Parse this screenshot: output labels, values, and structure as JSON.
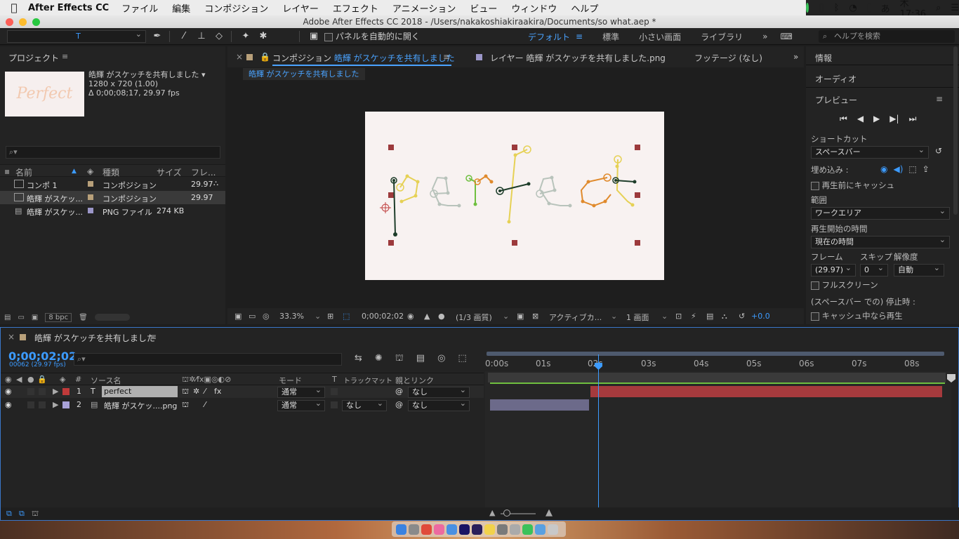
{
  "menubar": {
    "app_name": "After Effects CC",
    "items": [
      "ファイル",
      "編集",
      "コンポジション",
      "レイヤー",
      "エフェクト",
      "アニメーション",
      "ビュー",
      "ウィンドウ",
      "ヘルプ"
    ],
    "ime": "あ",
    "clock": "木 17:36"
  },
  "window_title": "Adobe After Effects CC 2018 - /Users/nakakoshiakiraakira/Documents/so what.aep *",
  "toolbar": {
    "auto_open_label": "パネルを自動的に開く",
    "workspaces": [
      "デフォルト",
      "標準",
      "小さい画面",
      "ライブラリ"
    ],
    "active_workspace": "デフォルト",
    "help_placeholder": "ヘルプを検索"
  },
  "project": {
    "title": "プロジェクト",
    "thumb_text": "Perfect",
    "selected_name": "皓輝 がスケッチを共有しました ▾",
    "selected_res": "1280 x 720 (1.00)",
    "selected_dur": "Δ 0;00;08;17, 29.97 fps",
    "columns": [
      "名前",
      "種類",
      "サイズ",
      "フレ..."
    ],
    "items": [
      {
        "name": "コンポ 1",
        "type": "コンポジション",
        "size": "",
        "fps": "29.97",
        "swatch": "#b8a07a"
      },
      {
        "name": "皓輝 がスケッ...",
        "type": "コンポジション",
        "size": "",
        "fps": "29.97",
        "swatch": "#b8a07a"
      },
      {
        "name": "皓輝 がスケッ...",
        "type": "PNG ファイル",
        "size": "274 KB",
        "fps": "",
        "swatch": "#9b96c8"
      }
    ],
    "bpc": "8 bpc"
  },
  "viewer": {
    "tab_comp_prefix": "コンポジション",
    "tab_comp_name": "皓輝 がスケッチを共有しました",
    "tab_layer": "レイヤー 皓輝 がスケッチを共有しました.png",
    "tab_footage": "フッテージ (なし)",
    "breadcrumb": "皓輝 がスケッチを共有しました",
    "zoom": "33.3%",
    "timecode": "0;00;02;02",
    "resolution": "(1/3 画質)",
    "camera": "アクティブカ...",
    "views": "1 画面",
    "exposure": "+0.0"
  },
  "right_panel": {
    "info": "情報",
    "audio": "オーディオ",
    "preview": "プレビュー",
    "shortcut_label": "ショートカット",
    "shortcut_value": "スペースバー",
    "embed_label": "埋め込み :",
    "cache_label": "再生前にキャッシュ",
    "range_label": "範囲",
    "range_value": "ワークエリア",
    "start_label": "再生開始の時間",
    "start_value": "現在の時間",
    "frame_label": "フレーム",
    "skip_label": "スキップ",
    "res_label": "解像度",
    "frame_value": "(29.97)",
    "skip_value": "0",
    "res_value": "自動",
    "fullscreen_label": "フルスクリーン",
    "stop_label": "(スペースバー での) 停止時 :",
    "play_label": "キャッシュ中なら再生"
  },
  "timeline": {
    "comp_name": "皓輝 がスケッチを共有しました",
    "timecode": "0;00;02;02",
    "frames": "00062 (29.97 fps)",
    "columns": {
      "hash": "#",
      "source": "ソース名",
      "mode": "モード",
      "t": "T",
      "trackmatte": "トラックマット",
      "parent": "親とリンク"
    },
    "layers": [
      {
        "index": "1",
        "type_icon": "T",
        "name": "perfect",
        "color": "#c03a3a",
        "mode": "通常",
        "matte": "",
        "parent": "なし"
      },
      {
        "index": "2",
        "type_icon": "▤",
        "name": "皓輝 がスケッ....png",
        "color": "#a8a2d8",
        "mode": "通常",
        "matte": "なし",
        "parent": "なし"
      }
    ],
    "ruler_ticks": [
      "0:00s",
      "01s",
      "02s",
      "03s",
      "04s",
      "05s",
      "06s",
      "07s",
      "08s"
    ]
  },
  "colors": {
    "accent": "#3c9bff",
    "layer1_bar": "#a63a3d",
    "layer2_bar": "#6c6a8a",
    "workarea_line": "#6fbf3f"
  }
}
